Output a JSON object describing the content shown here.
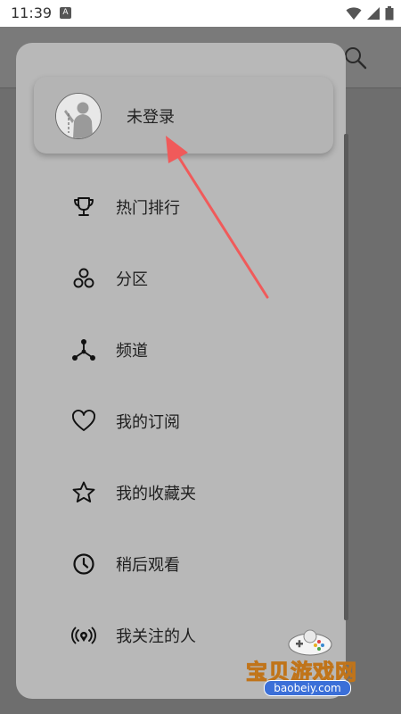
{
  "status_bar": {
    "time": "11:39",
    "notification_glyph": "A"
  },
  "background": {
    "search_icon": "search-icon"
  },
  "drawer": {
    "profile": {
      "name": "未登录",
      "avatar_icon": "avatar-silhouette"
    },
    "items": [
      {
        "label": "热门排行",
        "icon": "trophy-icon"
      },
      {
        "label": "分区",
        "icon": "partition-icon"
      },
      {
        "label": "频道",
        "icon": "channel-icon"
      },
      {
        "label": "我的订阅",
        "icon": "heart-icon"
      },
      {
        "label": "我的收藏夹",
        "icon": "star-icon"
      },
      {
        "label": "稍后观看",
        "icon": "clock-icon"
      },
      {
        "label": "我关注的人",
        "icon": "broadcast-icon"
      }
    ]
  },
  "watermark": {
    "title": "宝贝游戏网",
    "url": "baobeiy.com"
  },
  "colors": {
    "scrim": "#6e6e6e",
    "drawer_bg": "#b8b8b8",
    "annotation_arrow": "#f05a5a",
    "watermark_text": "#ffd23a",
    "watermark_url_bg": "#3b6fd8"
  }
}
